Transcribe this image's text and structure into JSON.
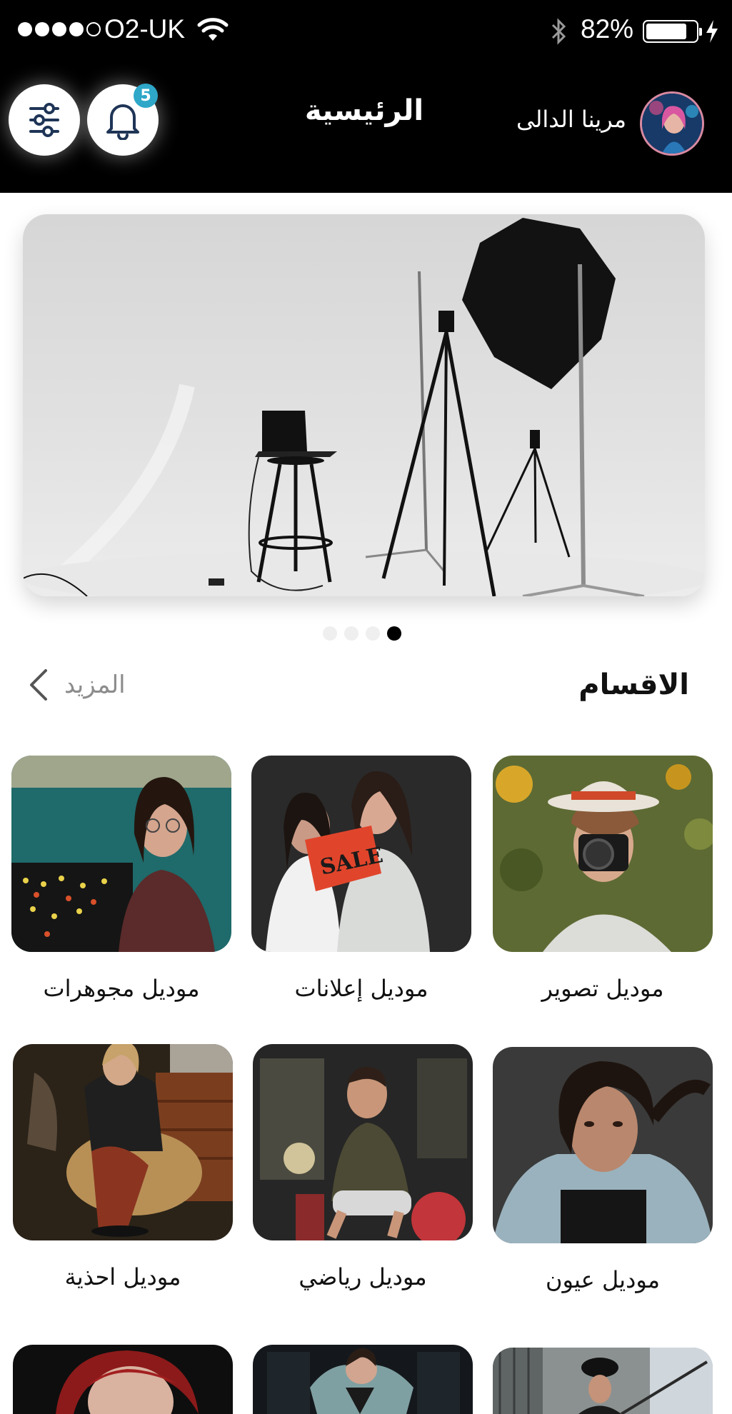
{
  "status_bar": {
    "carrier": "O2-UK",
    "battery": "82%",
    "battery_level": 0.82
  },
  "header": {
    "title": "الرئيسية",
    "user_name": "مرينا الدالى",
    "notifications_count": "5",
    "filter_icon": "sliders-icon",
    "bell_icon": "bell-icon"
  },
  "banner": {
    "pages": 4,
    "active_page": 4
  },
  "categories": {
    "title": "الاقسام",
    "more_label": "المزيد",
    "items": [
      {
        "label": "موديل تصوير"
      },
      {
        "label": "موديل إعلانات"
      },
      {
        "label": "موديل مجوهرات"
      },
      {
        "label": "موديل عيون"
      },
      {
        "label": "موديل رياضي"
      },
      {
        "label": "موديل احذية"
      }
    ]
  },
  "colors": {
    "header_bg": "#000000",
    "badge": "#2ea7c8",
    "icon_navy": "#1f3557",
    "muted_text": "#8c8c8c"
  }
}
